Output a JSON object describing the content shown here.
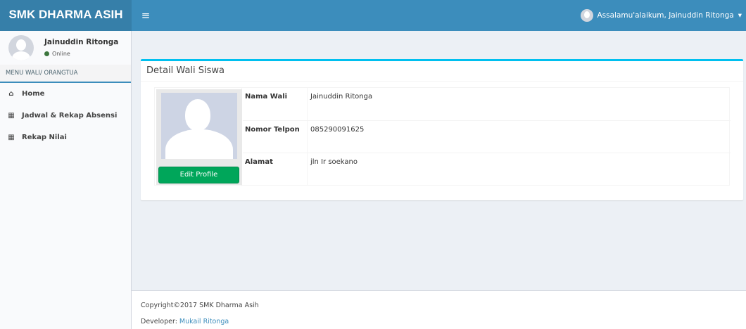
{
  "header": {
    "logo": "SMK DHARMA ASIH",
    "toggle_icon": "bars-icon",
    "greeting": "Assalamu'alaikum, Jainuddin Ritonga",
    "caret": "▾"
  },
  "sidebar": {
    "user_name": "Jainuddin Ritonga",
    "user_status": "Online",
    "menu_header": "MENU WALI/ ORANGTUA",
    "items": [
      {
        "label": "Home",
        "icon": "home-icon",
        "glyph": "⌂"
      },
      {
        "label": "Jadwal & Rekap Absensi",
        "icon": "calendar-icon",
        "glyph": "▦"
      },
      {
        "label": "Rekap Nilai",
        "icon": "th-large-icon",
        "glyph": "▦"
      }
    ]
  },
  "detail": {
    "title": "Detail Wali Siswa",
    "edit_button": "Edit Profile",
    "rows": [
      {
        "label": "Nama Wali",
        "value": "Jainuddin Ritonga"
      },
      {
        "label": "Nomor Telpon",
        "value": "085290091625"
      },
      {
        "label": "Alamat",
        "value": "jln Ir soekano"
      }
    ]
  },
  "footer": {
    "copyright": "Copyright©2017 SMK Dharma Asih",
    "developer_label": "Developer: ",
    "developer_name": "Mukail Ritonga"
  },
  "colors": {
    "navbar": "#3c8dbc",
    "logo_bg": "#367fa9",
    "box_accent": "#00c0ef",
    "button_green": "#00a65a"
  }
}
